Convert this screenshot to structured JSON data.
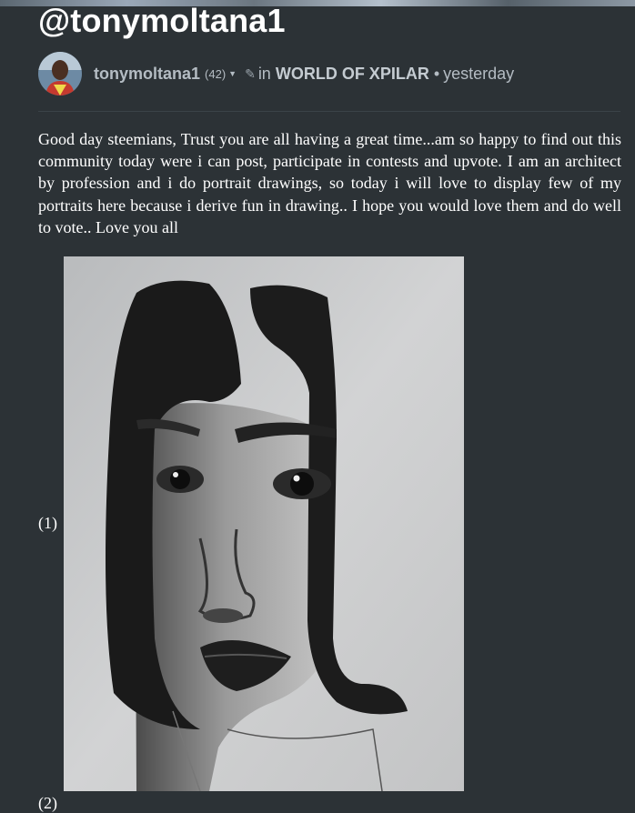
{
  "post": {
    "title": "@tonymoltana1",
    "author": "tonymoltana1",
    "reputation": "(42)",
    "in_label": "in",
    "community": "WORLD OF XPILAR",
    "separator": "•",
    "time": "yesterday",
    "body": "Good day steemians, Trust you are all having a great time...am so happy to find out this community today were i can post, participate in contests and upvote. I am an architect by profession and i do portrait drawings, so today i will love to display few of my portraits here because i derive fun in drawing.. I hope you would love them and do well to vote.. Love you all",
    "items": [
      {
        "label": "(1)"
      },
      {
        "label": "(2)"
      }
    ]
  },
  "icons": {
    "caret": "chevron-down-icon",
    "edit": "pencil-icon"
  },
  "colors": {
    "background": "#2c3236",
    "meta_text": "#b4bcc3",
    "title": "#ffffff"
  }
}
